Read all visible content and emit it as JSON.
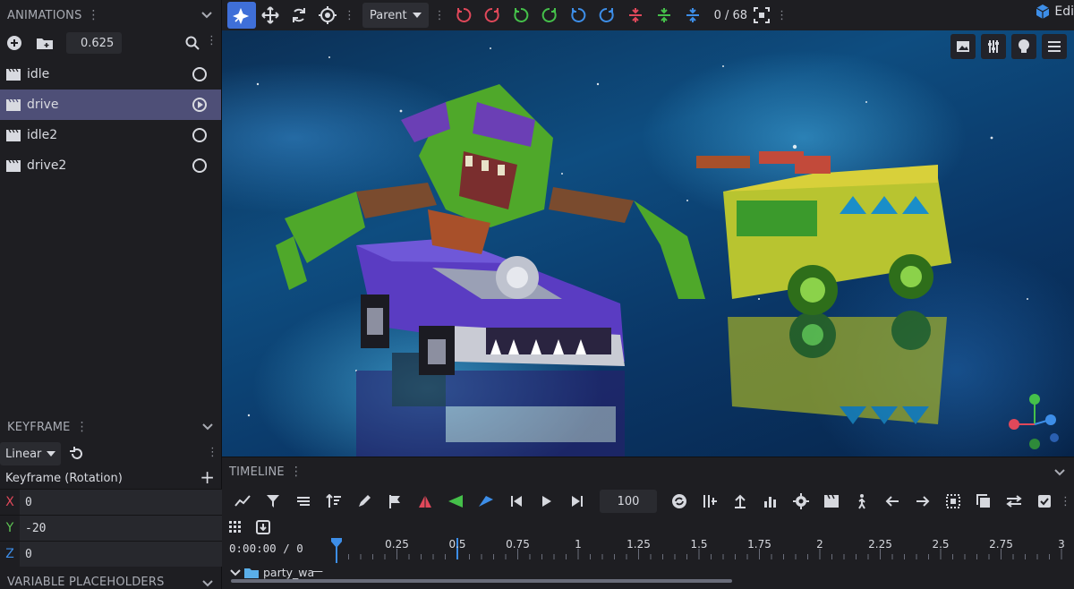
{
  "animations_panel": {
    "title": "ANIMATIONS",
    "speed_value": "0.625",
    "items": [
      {
        "label": "idle",
        "selected": false
      },
      {
        "label": "drive",
        "selected": true
      },
      {
        "label": "idle2",
        "selected": false
      },
      {
        "label": "drive2",
        "selected": false
      }
    ]
  },
  "keyframe_panel": {
    "title": "KEYFRAME",
    "interpolation": "Linear",
    "channel_title": "Keyframe (Rotation)",
    "axes": [
      {
        "letter": "X",
        "value": "0",
        "color": "#e0485a"
      },
      {
        "letter": "Y",
        "value": "-20",
        "color": "#5ec453"
      },
      {
        "letter": "Z",
        "value": "0",
        "color": "#3d8ee8"
      }
    ]
  },
  "variable_placeholders": {
    "title": "VARIABLE PLACEHOLDERS"
  },
  "toolbar": {
    "transform_space": "Parent",
    "frame_counter": "0 / 68",
    "edit_label": "Edi"
  },
  "timeline": {
    "title": "TIMELINE",
    "fps": "100",
    "time_readout": "0:00:00 / 0",
    "ticks": [
      "0.25",
      "0.5",
      "0.75",
      "1",
      "1.25",
      "1.5",
      "1.75",
      "2",
      "2.25",
      "2.5",
      "2.75",
      "3"
    ],
    "track_label": "party_wa",
    "playhead_time": 0,
    "loop_marker_time": 0.5
  },
  "colors": {
    "accent": "#3f6fd8",
    "selected_row": "#4e4f77",
    "red": "#e0485a",
    "green": "#45c04a",
    "blue": "#3d8ee8"
  }
}
